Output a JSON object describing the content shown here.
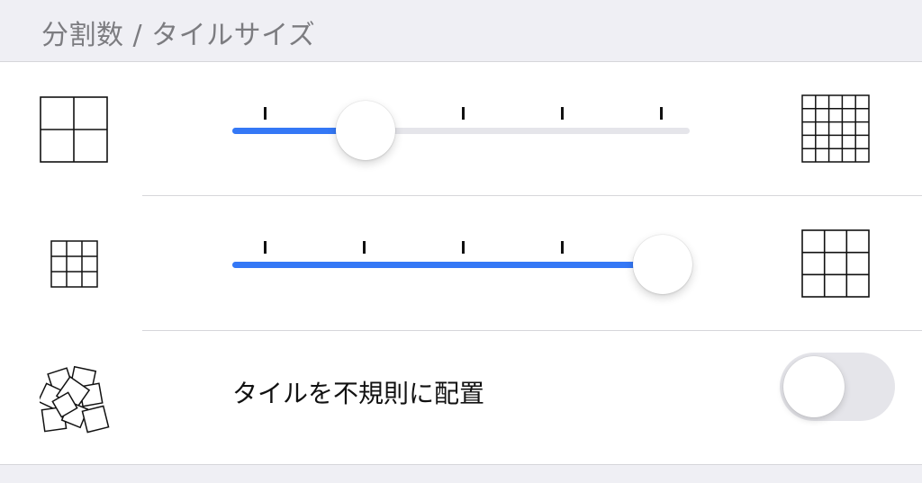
{
  "section": {
    "title": "分割数 / タイルサイズ"
  },
  "division_slider": {
    "min_icon": "grid-2x2-icon",
    "max_icon": "grid-5x5-icon",
    "steps": 5,
    "value_step": 2,
    "tick_steps": [
      1,
      3,
      4,
      5
    ]
  },
  "tile_size_slider": {
    "min_icon": "grid-3x3-small-icon",
    "max_icon": "grid-3x3-large-icon",
    "steps": 5,
    "value_step": 5,
    "tick_steps": [
      1,
      2,
      3,
      4
    ]
  },
  "irregular_tiles": {
    "icon": "scattered-tiles-icon",
    "label": "タイルを不規則に配置",
    "enabled": false
  },
  "colors": {
    "accent": "#3478f6",
    "track": "#e5e5ea",
    "background": "#efeff4"
  }
}
